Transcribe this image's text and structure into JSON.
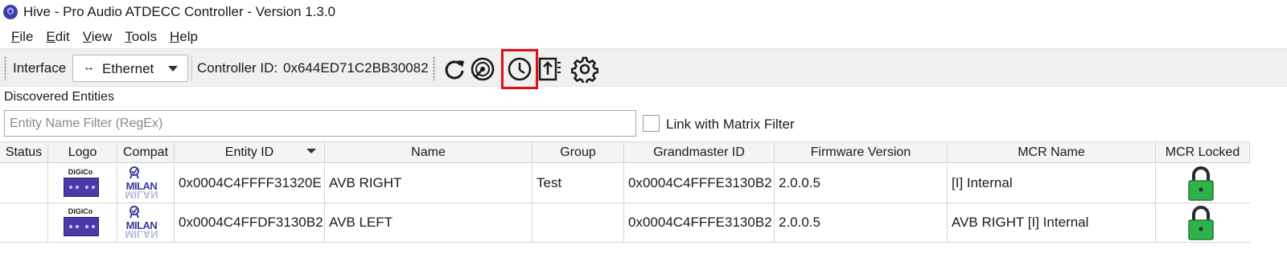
{
  "window": {
    "title": "Hive - Pro Audio ATDECC Controller - Version 1.3.0",
    "icon": "hive-app-icon"
  },
  "menu": [
    {
      "label": "File",
      "ul": "F",
      "rest": "ile"
    },
    {
      "label": "Edit",
      "ul": "E",
      "rest": "dit"
    },
    {
      "label": "View",
      "ul": "V",
      "rest": "iew"
    },
    {
      "label": "Tools",
      "ul": "T",
      "rest": "ools"
    },
    {
      "label": "Help",
      "ul": "H",
      "rest": "elp"
    }
  ],
  "toolbar": {
    "interface_label": "Interface",
    "interface_arrows": "↔",
    "interface_value": "Ethernet",
    "controller_id_label": "Controller ID:",
    "controller_id_value": "0x644ED71C2BB30082",
    "icons": [
      "refresh-icon",
      "discover-icon",
      "clock-icon",
      "upload-icon",
      "settings-gear-icon"
    ],
    "highlighted_icon": "clock-icon",
    "highlight_color": "#e0101b"
  },
  "entities": {
    "section_label": "Discovered Entities",
    "filter_placeholder": "Entity Name Filter (RegEx)",
    "link_label": "Link with Matrix Filter",
    "link_checked": false,
    "columns": [
      "Status",
      "Logo",
      "Compat",
      "Entity ID",
      "Name",
      "Group",
      "Grandmaster ID",
      "Firmware Version",
      "MCR Name",
      "MCR Locked"
    ],
    "sorted_column": "Entity ID",
    "rows": [
      {
        "status": "",
        "logo_brand": "DiGiCo",
        "compat": "MILAN",
        "entity_id": "0x0004C4FFFF31320E",
        "name": "AVB RIGHT",
        "group": "Test",
        "grandmaster_id": "0x0004C4FFFE3130B2",
        "firmware": "2.0.0.5",
        "mcr_name": "[I] Internal",
        "mcr_locked": "lock-icon"
      },
      {
        "status": "",
        "logo_brand": "DiGiCo",
        "compat": "MILAN",
        "entity_id": "0x0004C4FFDF3130B2",
        "name": "AVB LEFT",
        "group": "",
        "grandmaster_id": "0x0004C4FFFE3130B2",
        "firmware": "2.0.0.5",
        "mcr_name": "AVB RIGHT [I] Internal",
        "mcr_locked": "lock-icon"
      }
    ],
    "lock_color": "#2fb24a"
  }
}
